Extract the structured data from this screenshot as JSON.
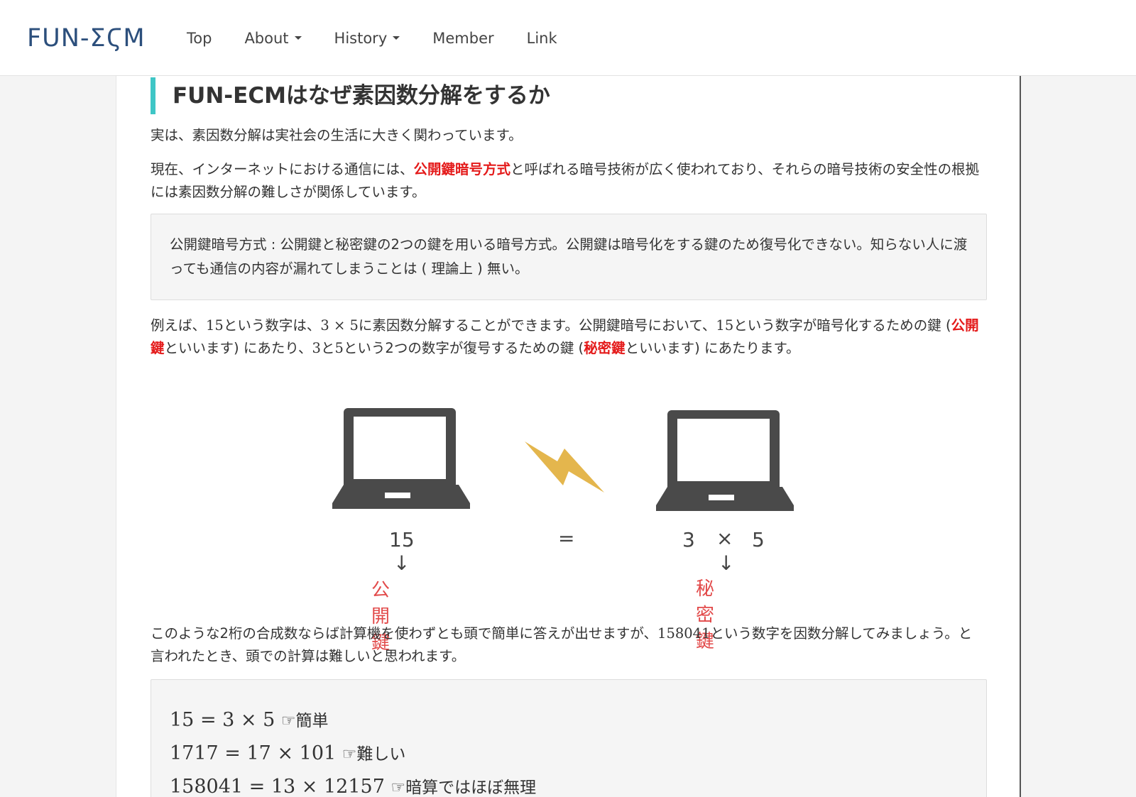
{
  "nav": {
    "logo": "FUN-ΣϚM",
    "items": [
      {
        "label": "Top",
        "dropdown": false
      },
      {
        "label": "About",
        "dropdown": true
      },
      {
        "label": "History",
        "dropdown": true
      },
      {
        "label": "Member",
        "dropdown": false
      },
      {
        "label": "Link",
        "dropdown": false
      }
    ]
  },
  "article": {
    "heading": "FUN-ECMはなぜ素因数分解をするか",
    "p1": "実は、素因数分解は実社会の生活に大きく関わっています。",
    "p2": {
      "pre": "現在、インターネットにおける通信には、",
      "highlight": "公開鍵暗号方式",
      "post": "と呼ばれる暗号技術が広く使われており、それらの暗号技術の安全性の根拠には素因数分解の難しさが関係しています。"
    },
    "note1": "公開鍵暗号方式 : 公開鍵と秘密鍵の2つの鍵を用いる暗号方式。公開鍵は暗号化をする鍵のため復号化できない。知らない人に渡っても通信の内容が漏れてしまうことは ( 理論上 ) 無い。",
    "p3": {
      "a": "例えば、",
      "n15": "15",
      "b": "という数字は、",
      "expr": "3 × 5",
      "c": "に素因数分解することができます。公開鍵暗号において、",
      "n15b": "15",
      "d": "という数字が暗号化するための鍵 (",
      "pub": "公開鍵",
      "e": "といいます) にあたり、",
      "n3": "3",
      "f": "と",
      "n5": "5",
      "g": "という2つの数字が復号するための鍵 (",
      "priv": "秘密鍵",
      "h": "といいます) にあたります。"
    },
    "diagram": {
      "left_number": "15",
      "equals": "=",
      "right_a": "3",
      "times": "×",
      "right_b": "5",
      "arrow": "↓",
      "left_key": "公開鍵",
      "right_key": "秘密鍵"
    },
    "p4": {
      "a": "このような2桁の合成数ならば計算機を使わずとも頭で簡単に答えが出せますが、",
      "num": "158041",
      "b": "という数字を因数分解してみましょう。と言われたとき、頭での計算は難しいと思われます。"
    },
    "examples": [
      {
        "expr": "15 = 3 × 5",
        "note": "☞簡単"
      },
      {
        "expr": "1717 = 17 × 101",
        "note": "☞難しい"
      },
      {
        "expr": "158041 = 13 × 12157",
        "note": "☞暗算ではほぼ無理"
      }
    ]
  },
  "colors": {
    "accent_bar": "#3fc6c6",
    "highlight": "#e41a1a",
    "logo": "#2c4f7c",
    "key_label": "#e24a4a",
    "laptop": "#4a4a4a",
    "bolt": "#e4b64d"
  }
}
